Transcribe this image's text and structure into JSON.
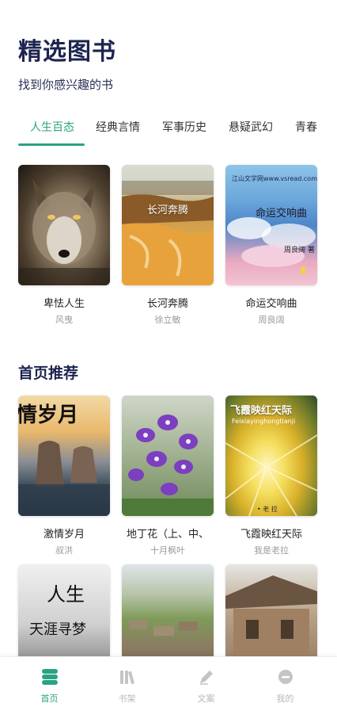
{
  "header": {
    "title": "精选图书",
    "subtitle": "找到你感兴趣的书"
  },
  "tabs": [
    {
      "label": "人生百态",
      "active": true
    },
    {
      "label": "经典言情",
      "active": false
    },
    {
      "label": "军事历史",
      "active": false
    },
    {
      "label": "悬疑武幻",
      "active": false
    },
    {
      "label": "青春",
      "active": false
    }
  ],
  "category_books": [
    {
      "title": "卑怯人生",
      "author": "风曳"
    },
    {
      "title": "长河奔腾",
      "author": "徐立敏",
      "cover_text": "长河奔腾"
    },
    {
      "title": "命运交响曲",
      "author": "周良阔",
      "cover_text": "命运交响曲",
      "cover_site": "江山文学网www.vsread.com",
      "cover_author": "周良阔 著"
    }
  ],
  "recommend": {
    "section_title": "首页推荐",
    "books": [
      {
        "title": "激情岁月",
        "author": "叔洪",
        "cover_text": "情岁月"
      },
      {
        "title": "地丁花（上、中、",
        "author": "十月枫叶"
      },
      {
        "title": "飞霞映红天际",
        "author": "我是老拉",
        "cover_text": "飞霞映红天际",
        "cover_pinyin": "Feixiayinghongtianji",
        "cover_author": "• 老 拉"
      },
      {
        "title": "",
        "author": "",
        "cover_text_1": "人生",
        "cover_text_2": "天涯寻梦"
      },
      {
        "title": "",
        "author": ""
      },
      {
        "title": "",
        "author": ""
      }
    ]
  },
  "tabbar": [
    {
      "label": "首页",
      "icon": "home-icon",
      "active": true
    },
    {
      "label": "书架",
      "icon": "bookshelf-icon",
      "active": false
    },
    {
      "label": "文案",
      "icon": "pen-icon",
      "active": false
    },
    {
      "label": "我的",
      "icon": "profile-icon",
      "active": false
    }
  ],
  "colors": {
    "accent": "#2aa385",
    "title": "#1d2450"
  }
}
